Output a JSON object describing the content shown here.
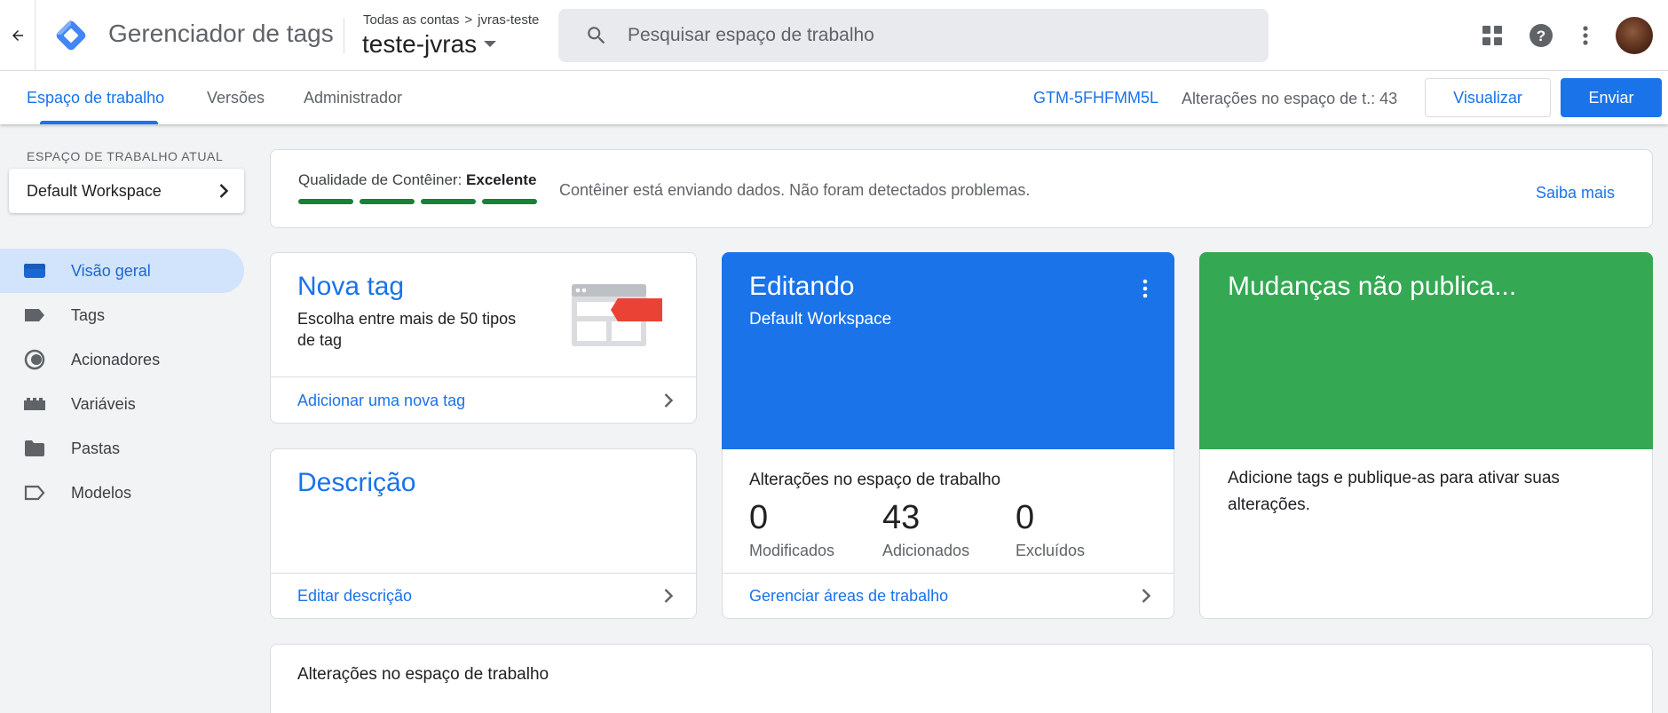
{
  "header": {
    "app_title": "Gerenciador de tags",
    "breadcrumb_root": "Todas as contas",
    "breadcrumb_separator": ">",
    "breadcrumb_account": "jvras-teste",
    "container_name": "teste-jvras",
    "search_placeholder": "Pesquisar espaço de trabalho",
    "icons": [
      "back-arrow-icon",
      "gtm-logo",
      "caret-down-icon",
      "search-icon",
      "apps-grid-icon",
      "help-icon",
      "more-vert-icon",
      "avatar"
    ]
  },
  "subnav": {
    "tabs": [
      "Espaço de trabalho",
      "Versões",
      "Administrador"
    ],
    "active_tab": "Espaço de trabalho",
    "container_id": "GTM-5FHFMM5L",
    "workspace_changes": "Alterações no espaço de t.: 43",
    "preview_label": "Visualizar",
    "submit_label": "Enviar"
  },
  "sidebar": {
    "workspace_label": "ESPAÇO DE TRABALHO ATUAL",
    "workspace_name": "Default Workspace",
    "items": [
      {
        "label": "Visão geral",
        "icon": "overview-icon",
        "active": true
      },
      {
        "label": "Tags",
        "icon": "tag-icon"
      },
      {
        "label": "Acionadores",
        "icon": "trigger-icon"
      },
      {
        "label": "Variáveis",
        "icon": "variable-icon"
      },
      {
        "label": "Pastas",
        "icon": "folder-icon"
      },
      {
        "label": "Modelos",
        "icon": "template-icon"
      }
    ]
  },
  "quality": {
    "label": "Qualidade de Contêiner:",
    "value": "Excelente",
    "score_bars": 4,
    "message": "Contêiner está enviando dados. Não foram detectados problemas.",
    "learn_more": "Saiba mais"
  },
  "new_tag_card": {
    "title": "Nova tag",
    "subtitle_line1": "Escolha entre mais de 50 tipos",
    "subtitle_line2": "de tag",
    "link": "Adicionar uma nova tag"
  },
  "description_card": {
    "title": "Descrição",
    "link": "Editar descrição"
  },
  "editing_card": {
    "title": "Editando",
    "workspace": "Default Workspace",
    "section_title": "Alterações no espaço de trabalho",
    "stats": [
      {
        "value": "0",
        "label": "Modificados"
      },
      {
        "value": "43",
        "label": "Adicionados"
      },
      {
        "value": "0",
        "label": "Excluídos"
      }
    ],
    "link": "Gerenciar áreas de trabalho",
    "colors": {
      "header": "#1a73e8"
    }
  },
  "unpublished_card": {
    "title": "Mudanças não publica...",
    "text_line1": "Adicione tags e publique-as para ativar suas",
    "text_line2": "alterações.",
    "colors": {
      "header": "#34a853"
    }
  },
  "changes_section": {
    "title": "Alterações no espaço de trabalho"
  },
  "colors": {
    "accent": "#1a73e8",
    "quality_good": "#188038",
    "background": "#f1f3f4"
  }
}
